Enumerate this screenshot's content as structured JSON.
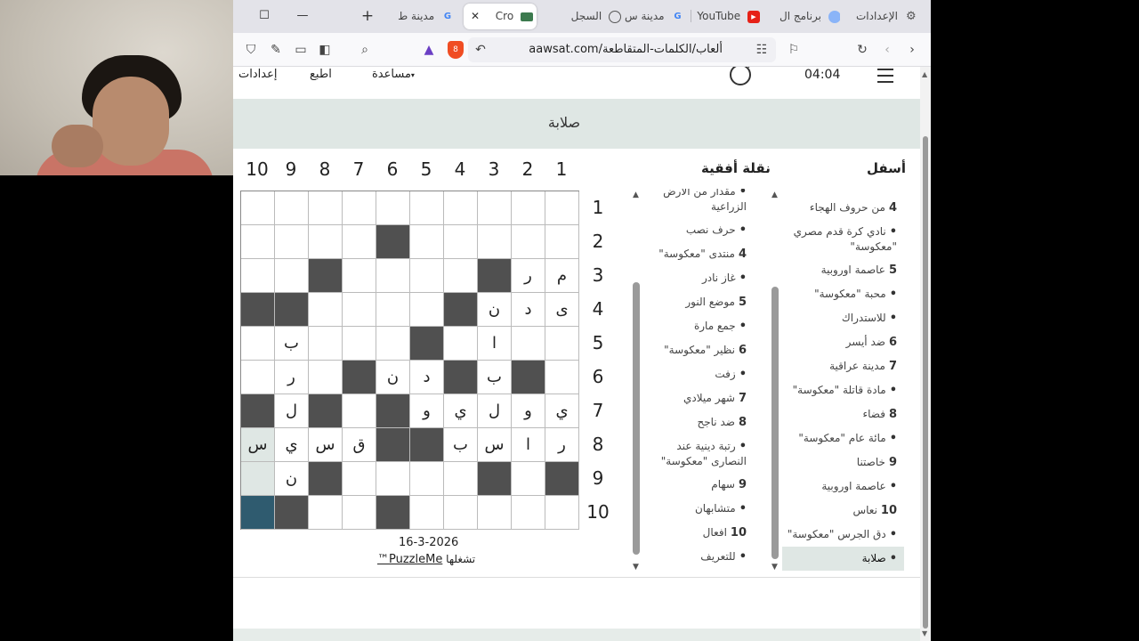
{
  "browser": {
    "tabs": [
      {
        "label": "الإعدادات",
        "icon": "gear-icon"
      },
      {
        "label": "برنامج ال",
        "icon": "app-icon"
      },
      {
        "label": "YouTube",
        "icon": "youtube-icon"
      },
      {
        "label": "مدينة س",
        "icon": "google-icon"
      },
      {
        "label": "السجل",
        "icon": "history-icon"
      },
      {
        "label": "Cro",
        "icon": "site-icon"
      },
      {
        "label": "مدينة ط",
        "icon": "google-icon"
      }
    ],
    "url": "aawsat.com/ألعاب/الكلمات-المتقاطعة",
    "brave_count": "8"
  },
  "topbar": {
    "settings": "إعدادات",
    "print": "اطبع",
    "help": "مساعدة",
    "timer": "04:04"
  },
  "current_clue": "صلابة",
  "puzzle": {
    "columns": [
      "10",
      "9",
      "8",
      "7",
      "6",
      "5",
      "4",
      "3",
      "2",
      "1"
    ],
    "rows": [
      "1",
      "2",
      "3",
      "4",
      "5",
      "6",
      "7",
      "8",
      "9",
      "10"
    ],
    "grid": [
      [
        "",
        "",
        "",
        "",
        "",
        "",
        "",
        "",
        "",
        ""
      ],
      [
        "",
        "",
        "",
        "",
        "#",
        "",
        "",
        "",
        "",
        ""
      ],
      [
        "",
        "",
        "#",
        "",
        "",
        "",
        "",
        "#",
        "ر",
        "م"
      ],
      [
        "#",
        "#",
        "",
        "",
        "",
        "",
        "#",
        "ن",
        "د",
        "ى"
      ],
      [
        "",
        "ب",
        "",
        "",
        "",
        "#",
        "",
        "ا",
        "",
        ""
      ],
      [
        "",
        "ر",
        "",
        "#",
        "ن",
        "د",
        "#",
        "ب",
        "#",
        ""
      ],
      [
        "#",
        "ل",
        "#",
        "",
        "#",
        "و",
        "ي",
        "ل",
        "و",
        "ي"
      ],
      [
        "س",
        "ي",
        "س",
        "ق",
        "#",
        "#",
        "ب",
        "س",
        "ا",
        "ر"
      ],
      [
        "",
        "ن",
        "#",
        "",
        "",
        "",
        "",
        "#",
        "",
        "#"
      ],
      [
        "",
        "#",
        "",
        "",
        "#",
        "",
        "",
        "",
        "",
        ""
      ]
    ],
    "highlighted": [
      [
        7,
        0
      ],
      [
        8,
        0
      ]
    ],
    "cursor": [
      9,
      0
    ],
    "date": "16-3-2026",
    "powered_by": "تشغلها",
    "brand": "PuzzleMe™"
  },
  "across": {
    "title": "نقلة أفقية",
    "clues": [
      {
        "num": "",
        "text": "مقدار من الأرض الزراعية"
      },
      {
        "num": "",
        "text": "حرف نصب"
      },
      {
        "num": "4",
        "text": "منتدى \"معكوسة\""
      },
      {
        "num": "",
        "text": "غاز نادر"
      },
      {
        "num": "5",
        "text": "موضع النور"
      },
      {
        "num": "",
        "text": "جمع مارة"
      },
      {
        "num": "6",
        "text": "نظير \"معكوسة\""
      },
      {
        "num": "",
        "text": "زفت"
      },
      {
        "num": "7",
        "text": "شهر ميلادي"
      },
      {
        "num": "8",
        "text": "ضد ناجح"
      },
      {
        "num": "",
        "text": "رتبة دينية عند النصارى \"معكوسة\""
      },
      {
        "num": "9",
        "text": "سهام"
      },
      {
        "num": "",
        "text": "متشابهان"
      },
      {
        "num": "10",
        "text": "افعال"
      },
      {
        "num": "",
        "text": "للتعريف"
      }
    ]
  },
  "down": {
    "title": "أسفل",
    "clues": [
      {
        "num": "4",
        "text": "من حروف الهجاء"
      },
      {
        "num": "",
        "text": "نادي كرة قدم مصري \"معكوسة\""
      },
      {
        "num": "5",
        "text": "عاصمة اوروبية"
      },
      {
        "num": "",
        "text": "محبة \"معكوسة\""
      },
      {
        "num": "",
        "text": "للاستدراك"
      },
      {
        "num": "6",
        "text": "ضد أيسر"
      },
      {
        "num": "7",
        "text": "مدينة عراقية"
      },
      {
        "num": "",
        "text": "مادة قاتلة \"معكوسة\""
      },
      {
        "num": "8",
        "text": "فضاء"
      },
      {
        "num": "",
        "text": "مائة عام \"معكوسة\""
      },
      {
        "num": "9",
        "text": "خاصتنا"
      },
      {
        "num": "",
        "text": "عاصمة اوروبية"
      },
      {
        "num": "10",
        "text": "نعاس"
      },
      {
        "num": "",
        "text": "دق الجرس \"معكوسة\""
      },
      {
        "num": "",
        "text": "صلابة",
        "active": true
      }
    ]
  },
  "colors": {
    "block": "#505050",
    "highlight": "#dfe7e4",
    "cursor": "#2f5b6f"
  }
}
